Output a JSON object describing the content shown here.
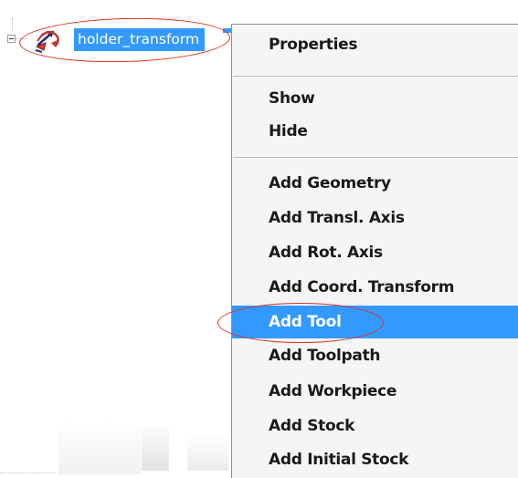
{
  "tree": {
    "node_label": "holder_transform",
    "node_icon": "transform-node-icon",
    "expanded": true
  },
  "context_menu": {
    "items": [
      {
        "label": "Properties"
      },
      {
        "label": "Show"
      },
      {
        "label": "Hide"
      },
      {
        "label": "Add Geometry"
      },
      {
        "label": "Add Transl. Axis"
      },
      {
        "label": "Add Rot. Axis"
      },
      {
        "label": "Add Coord. Transform"
      },
      {
        "label": "Add Tool",
        "highlighted": true
      },
      {
        "label": "Add Toolpath"
      },
      {
        "label": "Add Workpiece"
      },
      {
        "label": "Add Stock"
      },
      {
        "label": "Add Initial Stock"
      }
    ]
  },
  "colors": {
    "selection": "#3399ff",
    "annotation": "#e0301e",
    "menu_background": "#f5f5f5"
  }
}
